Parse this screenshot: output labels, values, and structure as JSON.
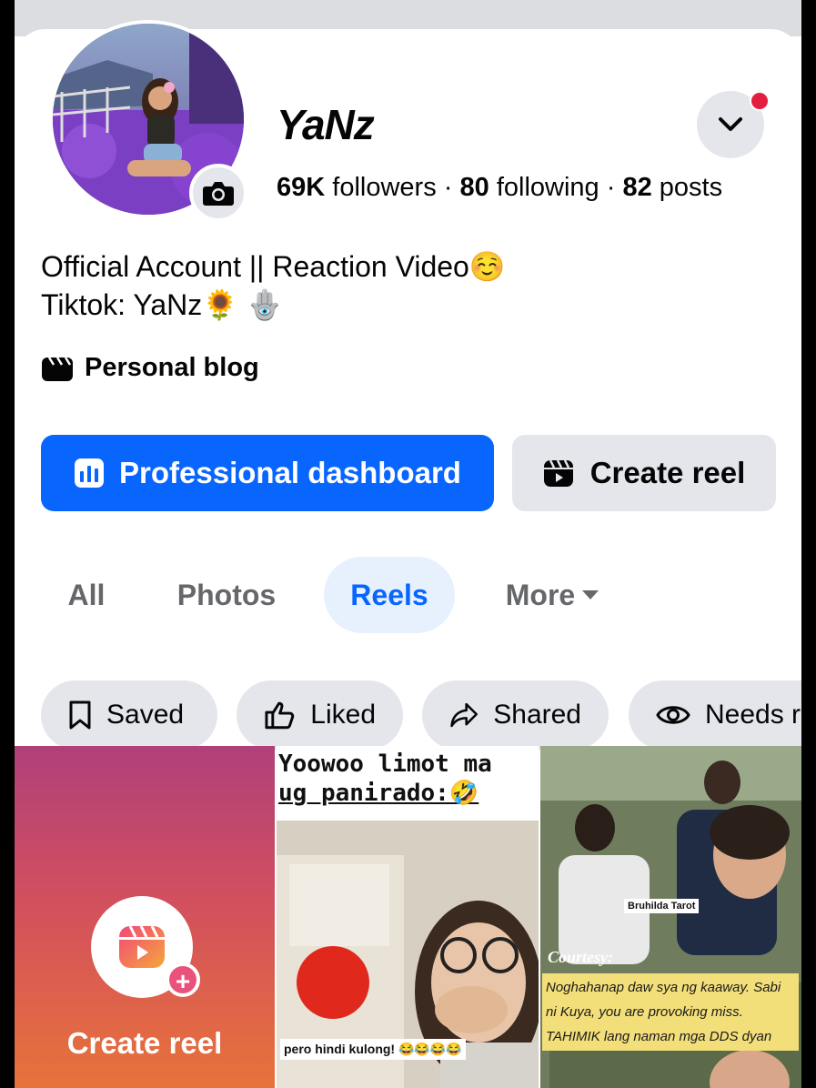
{
  "profile": {
    "name": "YaNz",
    "followers_count": "69K",
    "followers_label": "followers",
    "following_count": "80",
    "following_label": "following",
    "posts_count": "82",
    "posts_label": "posts",
    "separator": "·",
    "bio_line1": "Official Account || Reaction Video☺️",
    "bio_line2": "Tiktok: YaNz🌻 🪬",
    "category": "Personal blog"
  },
  "actions": {
    "professional_dashboard": "Professional dashboard",
    "create_reel": "Create reel"
  },
  "tabs": [
    {
      "label": "All"
    },
    {
      "label": "Photos"
    },
    {
      "label": "Reels",
      "active": true
    },
    {
      "label": "More"
    }
  ],
  "filters": [
    {
      "label": "Saved",
      "icon": "bookmark-icon"
    },
    {
      "label": "Liked",
      "icon": "thumbs-up-icon"
    },
    {
      "label": "Shared",
      "icon": "share-icon"
    },
    {
      "label": "Needs r",
      "icon": "eye-icon"
    }
  ],
  "reels": {
    "create_label": "Create reel",
    "items": [
      {
        "caption_line1": "Yoowoo limot ma",
        "caption_line2": "ug panirado:🤣",
        "subtitle": "pero hindi kulong! 😂😂😂😂"
      },
      {
        "tag": "Bruhilda Tarot",
        "courtesy": "Courtesy:",
        "caption": "Noghahanap daw sya ng kaaway. Sabi ni Kuya, you are provoking miss. TAHIMIK lang naman mga DDS dyan"
      }
    ]
  },
  "colors": {
    "primary_blue": "#0866ff",
    "tab_active_bg": "#e7f0fd",
    "chip_bg": "#e4e6eb",
    "notification_red": "#e41e3f"
  }
}
